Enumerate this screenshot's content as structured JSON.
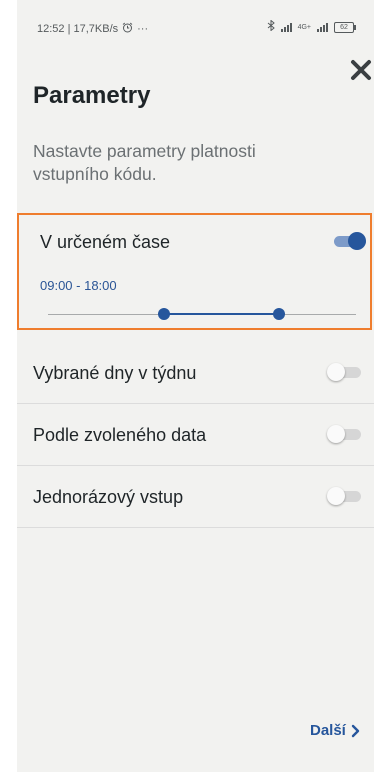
{
  "status_bar": {
    "left_text": "12:52 | 17,7KB/s",
    "alarm_icon": "alarm-clock-icon",
    "dots": "···",
    "bluetooth_icon": "bluetooth-icon",
    "network_label": "4G+",
    "battery": "62"
  },
  "header": {
    "title": "Parametry",
    "close_icon": "close-icon",
    "subtitle": "Nastavte parametry platnosti vstupního kódu."
  },
  "options": [
    {
      "label": "V určeném čase",
      "enabled": true,
      "range_text": "09:00 - 18:00",
      "range_start_fraction": 0.375,
      "range_end_fraction": 0.75
    },
    {
      "label": "Vybrané dny v týdnu",
      "enabled": false
    },
    {
      "label": "Podle zvoleného data",
      "enabled": false
    },
    {
      "label": "Jednorázový vstup",
      "enabled": false
    }
  ],
  "footer": {
    "next_label": "Další",
    "next_icon": "chevron-right-icon"
  },
  "colors": {
    "accent": "#26569c",
    "highlight_border": "#ef7d2e",
    "panel_background": "#f2f2f0",
    "text_dark": "#1f2528",
    "text_muted": "#6b7073"
  }
}
